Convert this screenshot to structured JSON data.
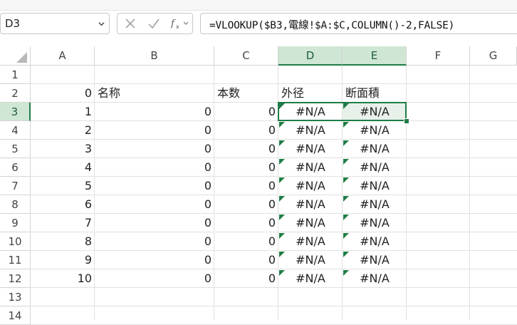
{
  "name_box": {
    "value": "D3"
  },
  "formula_bar": {
    "formula": "=VLOOKUP($B3,電線!$A:$C,COLUMN()-2,FALSE)"
  },
  "columns": [
    "A",
    "B",
    "C",
    "D",
    "E",
    "F",
    "G"
  ],
  "selected_columns": [
    "D",
    "E"
  ],
  "rows": [
    "1",
    "2",
    "3",
    "4",
    "5",
    "6",
    "7",
    "8",
    "9",
    "10",
    "11",
    "12",
    "13",
    "14"
  ],
  "selected_row": "3",
  "header_row": {
    "A": "0",
    "B": "名称",
    "C": "本数",
    "D": "外径",
    "E": "断面積"
  },
  "data_rows": [
    {
      "A": "1",
      "B": "0",
      "C": "0",
      "D": "#N/A",
      "E": "#N/A"
    },
    {
      "A": "2",
      "B": "0",
      "C": "0",
      "D": "#N/A",
      "E": "#N/A"
    },
    {
      "A": "3",
      "B": "0",
      "C": "0",
      "D": "#N/A",
      "E": "#N/A"
    },
    {
      "A": "4",
      "B": "0",
      "C": "0",
      "D": "#N/A",
      "E": "#N/A"
    },
    {
      "A": "5",
      "B": "0",
      "C": "0",
      "D": "#N/A",
      "E": "#N/A"
    },
    {
      "A": "6",
      "B": "0",
      "C": "0",
      "D": "#N/A",
      "E": "#N/A"
    },
    {
      "A": "7",
      "B": "0",
      "C": "0",
      "D": "#N/A",
      "E": "#N/A"
    },
    {
      "A": "8",
      "B": "0",
      "C": "0",
      "D": "#N/A",
      "E": "#N/A"
    },
    {
      "A": "9",
      "B": "0",
      "C": "0",
      "D": "#N/A",
      "E": "#N/A"
    },
    {
      "A": "10",
      "B": "0",
      "C": "0",
      "D": "#N/A",
      "E": "#N/A"
    }
  ],
  "colors": {
    "accent": "#1e7d45",
    "selected_header": "#cfe6d5",
    "grid": "#e1e1e1"
  },
  "icons": {
    "cancel": "cancel-x-icon",
    "enter": "enter-check-icon",
    "function": "insert-function-icon"
  }
}
